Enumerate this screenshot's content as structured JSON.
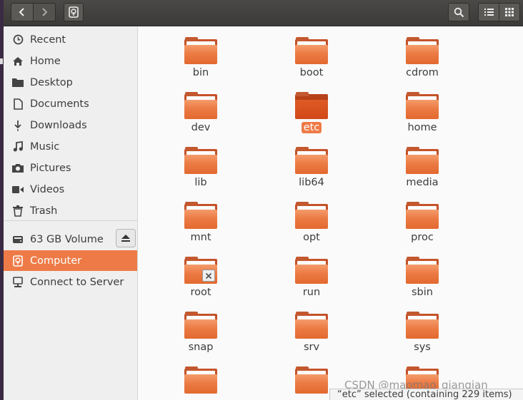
{
  "icons": {
    "back": "chevron-left-icon",
    "forward": "chevron-right-icon",
    "path": "computer-icon",
    "search": "search-icon",
    "list_view": "list-view-icon",
    "grid_view": "grid-view-icon",
    "eject": "eject-icon"
  },
  "colors": {
    "accent": "#ee7b47",
    "folder": "#ec7b44",
    "headerbar": "#3b3a38"
  },
  "sidebar": {
    "items": [
      {
        "label": "Recent",
        "icon": "clock-icon"
      },
      {
        "label": "Home",
        "icon": "home-icon"
      },
      {
        "label": "Desktop",
        "icon": "folder-icon"
      },
      {
        "label": "Documents",
        "icon": "document-icon"
      },
      {
        "label": "Downloads",
        "icon": "download-icon"
      },
      {
        "label": "Music",
        "icon": "music-icon"
      },
      {
        "label": "Pictures",
        "icon": "camera-icon"
      },
      {
        "label": "Videos",
        "icon": "video-icon"
      },
      {
        "label": "Trash",
        "icon": "trash-icon"
      }
    ],
    "devices": [
      {
        "label": "63 GB Volume",
        "icon": "drive-icon"
      },
      {
        "label": "Computer",
        "icon": "computer-icon",
        "active": true
      },
      {
        "label": "Connect to Server",
        "icon": "server-icon"
      }
    ]
  },
  "folders": [
    {
      "name": "bin"
    },
    {
      "name": "boot"
    },
    {
      "name": "cdrom"
    },
    {
      "name": "dev"
    },
    {
      "name": "etc",
      "selected": true
    },
    {
      "name": "home"
    },
    {
      "name": "lib"
    },
    {
      "name": "lib64"
    },
    {
      "name": "media"
    },
    {
      "name": "mnt"
    },
    {
      "name": "opt"
    },
    {
      "name": "proc"
    },
    {
      "name": "root",
      "emblem": "locked-icon"
    },
    {
      "name": "run"
    },
    {
      "name": "sbin"
    },
    {
      "name": "snap"
    },
    {
      "name": "srv"
    },
    {
      "name": "sys"
    },
    {
      "name": ""
    },
    {
      "name": ""
    },
    {
      "name": ""
    }
  ],
  "status": {
    "text": "“etc” selected  (containing 229 items)"
  },
  "watermark": {
    "text": "CSDN @maomao_qianqian"
  }
}
